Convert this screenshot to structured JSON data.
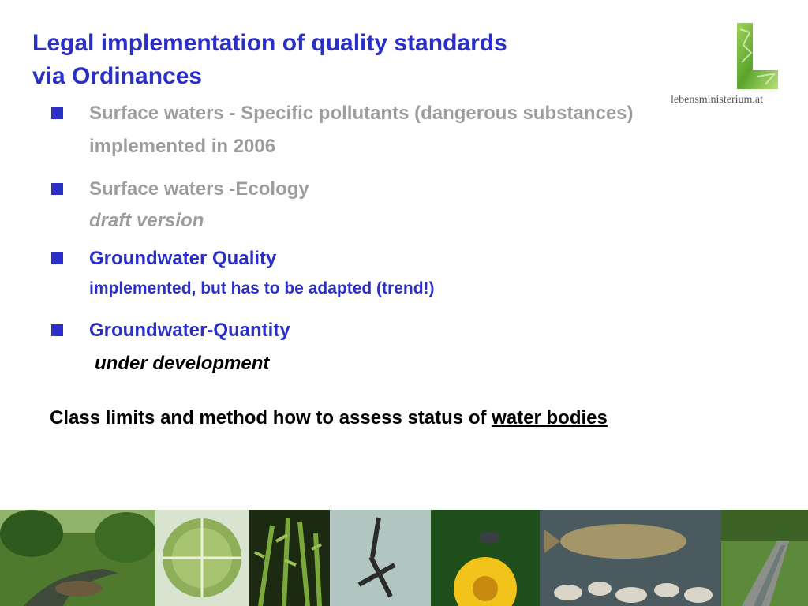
{
  "slide": {
    "title_line1": "Legal implementation of quality standards",
    "title_line2": "via Ordinances"
  },
  "logo": {
    "text": "lebensministerium.at",
    "letter": "L"
  },
  "bullets": [
    {
      "main": "Surface waters - Specific pollutants (dangerous substances)",
      "sub": "implemented in 2006"
    },
    {
      "main": "Surface waters -Ecology",
      "sub": "draft version"
    },
    {
      "main": "Groundwater Quality",
      "sub": "implemented, but has to be adapted (trend!)"
    },
    {
      "main": "Groundwater-Quantity",
      "sub": "under development"
    }
  ],
  "conclusion": {
    "prefix": "Class limits and method how to assess status of ",
    "link": "water bodies"
  },
  "colors": {
    "title_blue": "#2b2fc8",
    "muted_grey": "#9d9d9d"
  },
  "photos": [
    "stream-landscape-photo",
    "algae-microscope-photo",
    "water-plant-photo",
    "insect-larvae-photo",
    "flower-insect-photo",
    "fish-photo",
    "channelized-stream-photo"
  ]
}
